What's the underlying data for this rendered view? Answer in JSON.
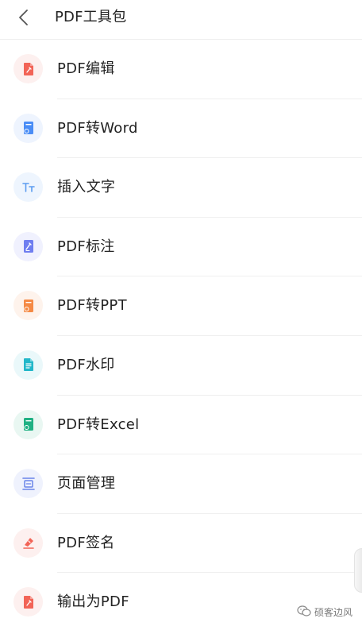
{
  "header": {
    "back_icon": "chevron-left-icon",
    "title": "PDF工具包"
  },
  "tools": [
    {
      "id": "pdf-edit",
      "label": "PDF编辑",
      "icon": "pdf-edit-icon",
      "color": "#f26457",
      "bg": "#fdf0ef"
    },
    {
      "id": "pdf-to-word",
      "label": "PDF转Word",
      "icon": "pdf-to-word-icon",
      "color": "#4a8df6",
      "bg": "#eef4fe"
    },
    {
      "id": "insert-text",
      "label": "插入文字",
      "icon": "text-tt-icon",
      "color": "#5b9cf0",
      "bg": "#eef5fe"
    },
    {
      "id": "pdf-annotate",
      "label": "PDF标注",
      "icon": "pdf-annotate-icon",
      "color": "#6f7ef0",
      "bg": "#f0f1fe"
    },
    {
      "id": "pdf-to-ppt",
      "label": "PDF转PPT",
      "icon": "pdf-to-ppt-icon",
      "color": "#f58a45",
      "bg": "#fef3ec"
    },
    {
      "id": "pdf-watermark",
      "label": "PDF水印",
      "icon": "pdf-watermark-icon",
      "color": "#22b7c9",
      "bg": "#eaf8fa"
    },
    {
      "id": "pdf-to-excel",
      "label": "PDF转Excel",
      "icon": "pdf-to-excel-icon",
      "color": "#1fb083",
      "bg": "#e9f7f2"
    },
    {
      "id": "page-manage",
      "label": "页面管理",
      "icon": "page-manage-icon",
      "color": "#6a84ea",
      "bg": "#eff2fd"
    },
    {
      "id": "pdf-sign",
      "label": "PDF签名",
      "icon": "pen-sign-icon",
      "color": "#f26457",
      "bg": "#fdf0ef"
    },
    {
      "id": "export-pdf",
      "label": "输出为PDF",
      "icon": "export-pdf-icon",
      "color": "#f26457",
      "bg": "#fdf0ef"
    }
  ],
  "watermark": {
    "icon": "wechat-icon",
    "text": "硕客边风"
  }
}
